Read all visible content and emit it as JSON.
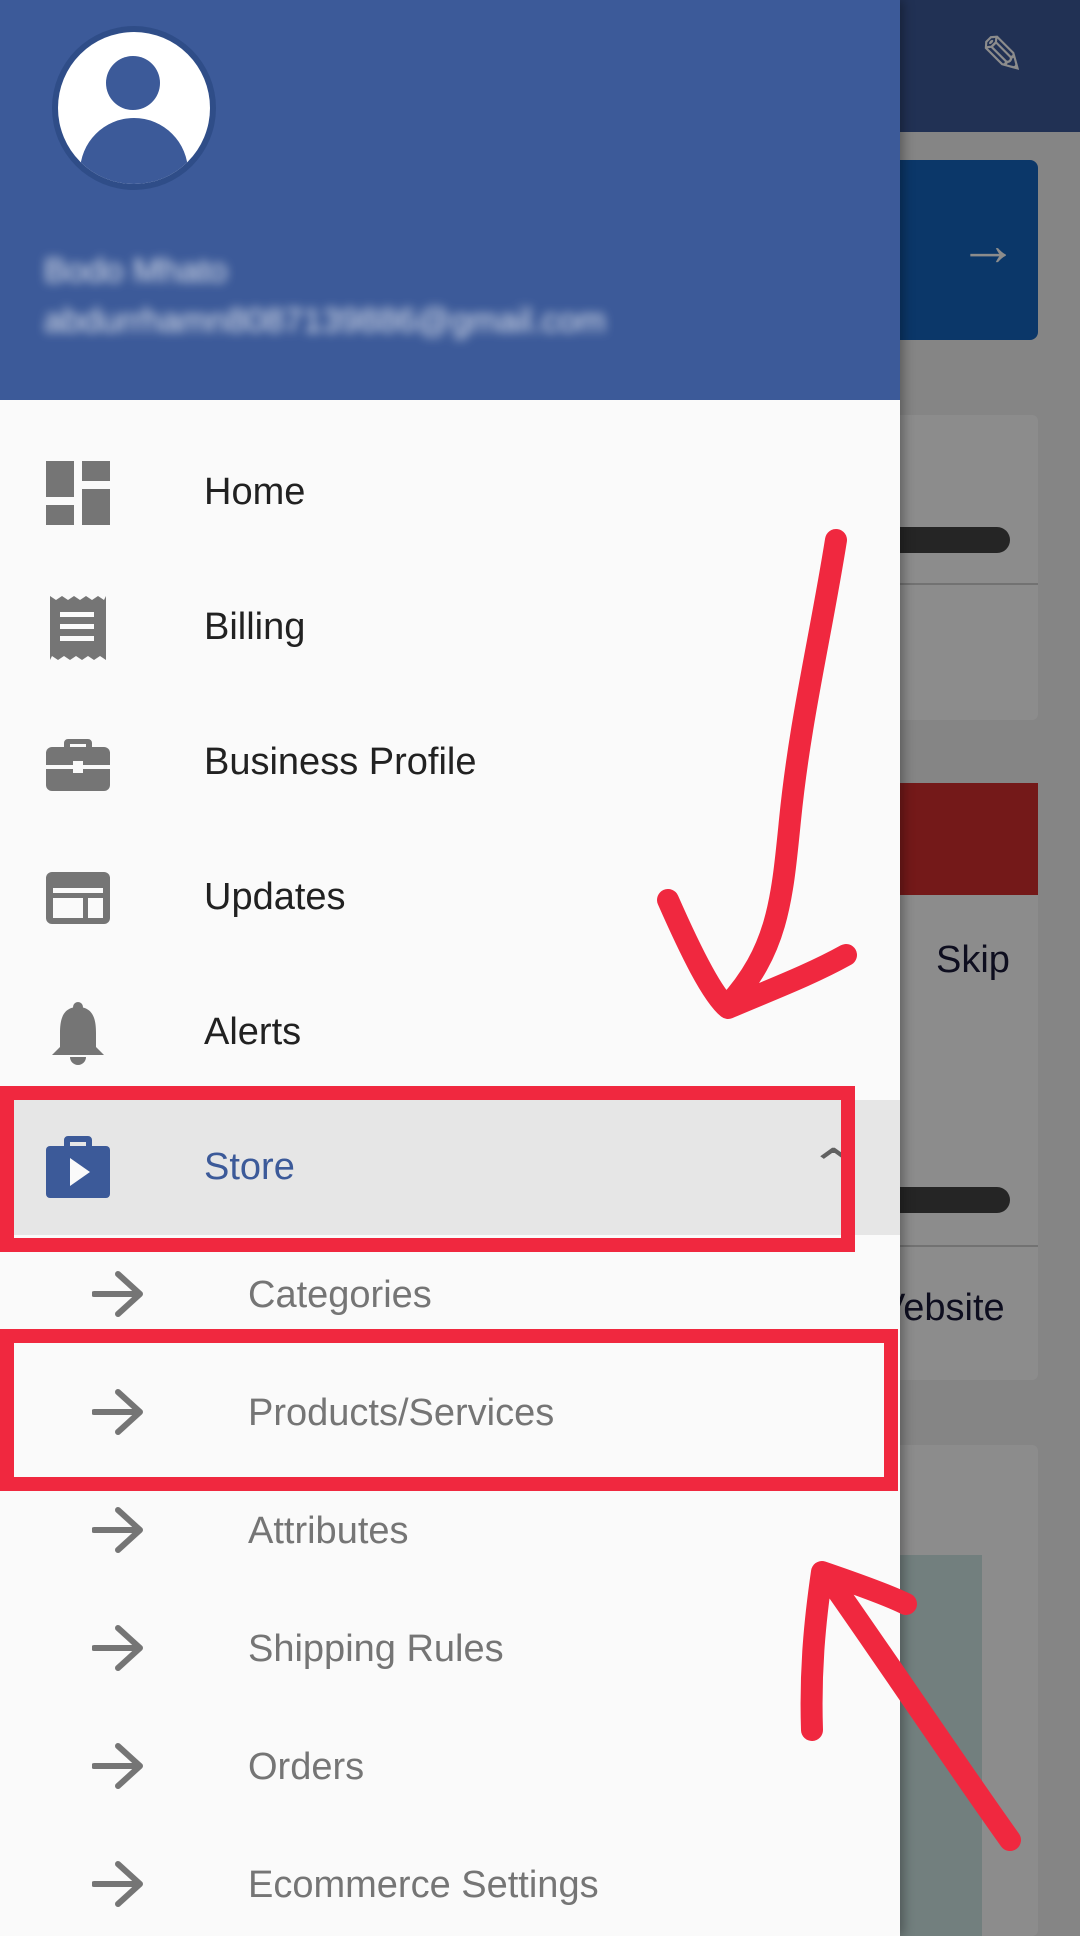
{
  "drawer": {
    "user": {
      "name": "Bodo Mhato",
      "email": "abdurrhamn8087139886@gmail.com"
    },
    "items": [
      {
        "label": "Home",
        "icon": "dashboard-icon"
      },
      {
        "label": "Billing",
        "icon": "receipt-icon"
      },
      {
        "label": "Business Profile",
        "icon": "briefcase-icon"
      },
      {
        "label": "Updates",
        "icon": "web-icon"
      },
      {
        "label": "Alerts",
        "icon": "bell-icon"
      },
      {
        "label": "Store",
        "icon": "store-icon",
        "expanded": true
      }
    ],
    "store_subitems": [
      {
        "label": "Categories"
      },
      {
        "label": "Products/Services"
      },
      {
        "label": "Attributes"
      },
      {
        "label": "Shipping Rules"
      },
      {
        "label": "Orders"
      },
      {
        "label": "Ecommerce Settings"
      }
    ]
  },
  "background": {
    "skip_label": "Skip",
    "website_label": "Vebsite"
  },
  "colors": {
    "primary": "#3c5a99",
    "annotation": "#f0283f",
    "drawer_bg": "#fafafa",
    "selected_bg": "#e6e6e6"
  }
}
